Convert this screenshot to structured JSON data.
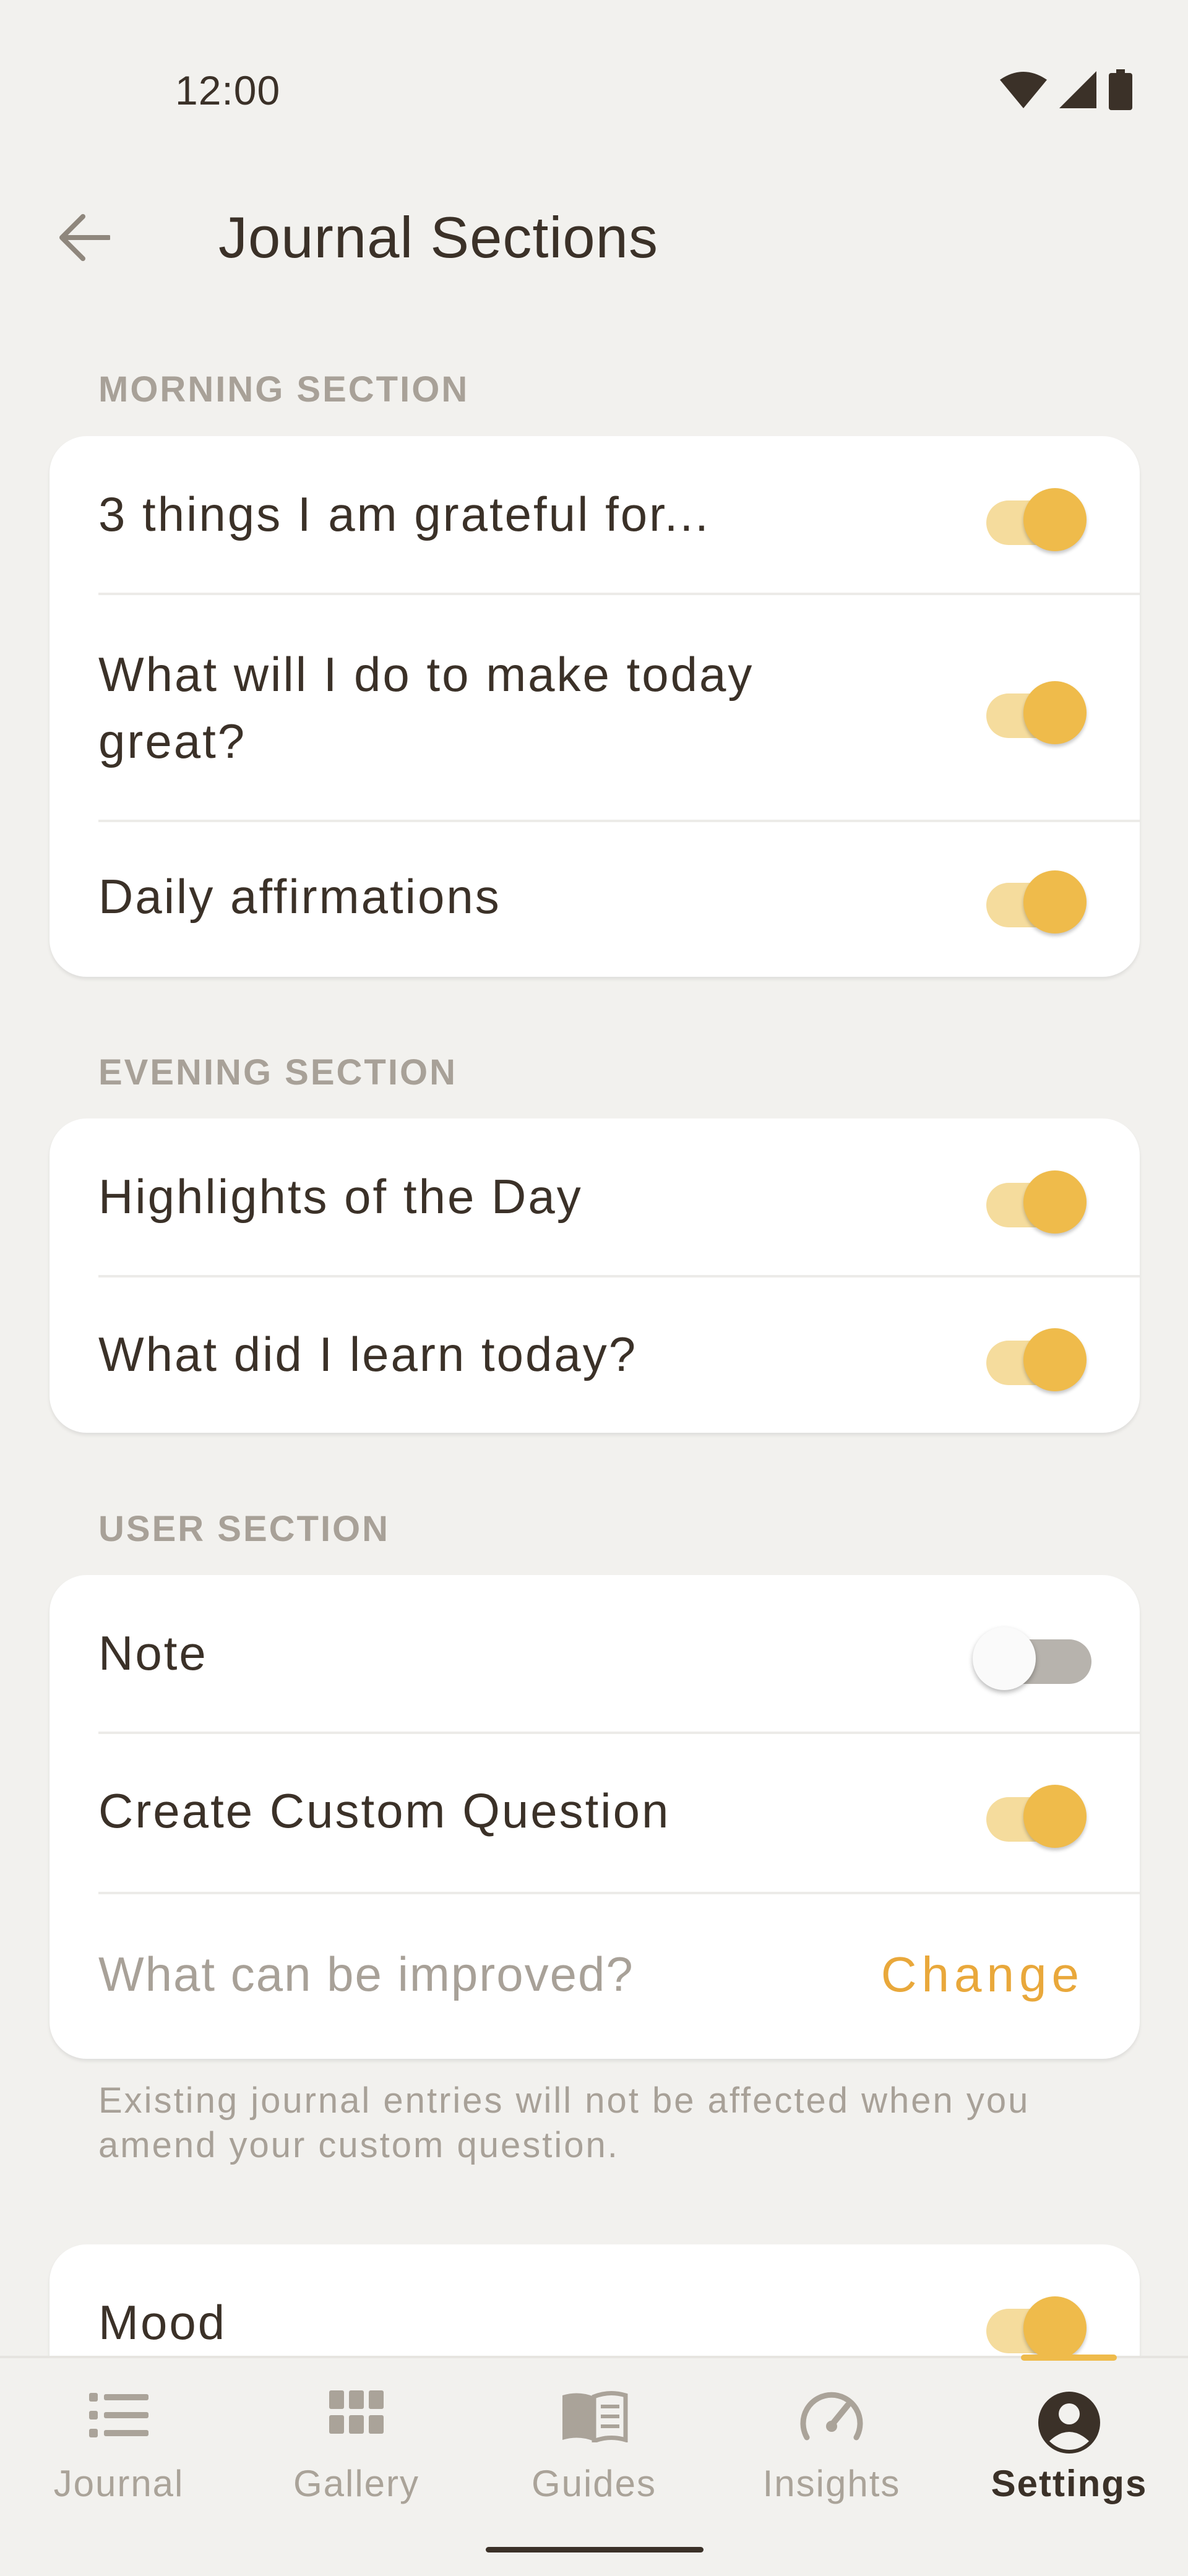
{
  "status": {
    "time": "12:00"
  },
  "header": {
    "title": "Journal Sections"
  },
  "sections": {
    "morning": {
      "title": "MORNING SECTION",
      "items": [
        {
          "label": "3 things I am grateful for...",
          "enabled": true
        },
        {
          "label": "What will I do to make today great?",
          "enabled": true
        },
        {
          "label": "Daily affirmations",
          "enabled": true
        }
      ]
    },
    "evening": {
      "title": "EVENING SECTION",
      "items": [
        {
          "label": "Highlights of the Day",
          "enabled": true
        },
        {
          "label": "What did I learn today?",
          "enabled": true
        }
      ]
    },
    "user": {
      "title": "USER SECTION",
      "items": [
        {
          "label": "Note",
          "enabled": false
        },
        {
          "label": "Create Custom Question",
          "enabled": true
        }
      ],
      "custom_question": "What can be improved?",
      "change_label": "Change",
      "hint": "Existing journal entries will not be affected when you amend your custom question."
    },
    "mood": {
      "label": "Mood",
      "enabled": true
    }
  },
  "bottom_nav": {
    "items": [
      {
        "label": "Journal",
        "icon": "list-icon"
      },
      {
        "label": "Gallery",
        "icon": "grid-icon"
      },
      {
        "label": "Guides",
        "icon": "book-icon"
      },
      {
        "label": "Insights",
        "icon": "gauge-icon"
      },
      {
        "label": "Settings",
        "icon": "account-circle-icon"
      }
    ],
    "active": "Settings"
  },
  "colors": {
    "accent": "#efbb4b",
    "accent_light": "#f5dc9d",
    "text": "#3b3128",
    "muted": "#a8a198",
    "background": "#f2f1ee"
  }
}
